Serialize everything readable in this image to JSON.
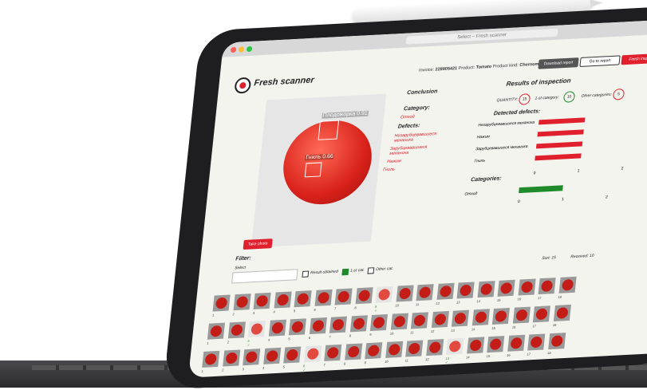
{
  "browser": {
    "url": "Select – Fresh scanner"
  },
  "app": {
    "brand": "Fresh scanner"
  },
  "header": {
    "invoice_label": "Invoice:",
    "invoice_value": "228905421",
    "product_label": "Product:",
    "product_value": "Tomato",
    "kind_label": "Product kind:",
    "kind_value": "Chernomor",
    "download_label": "Download report",
    "goto_label": "Go to report",
    "finish_label": "Finish inspection"
  },
  "photo": {
    "detections": [
      {
        "label": "Плодожорка 0.91"
      },
      {
        "label": "Гниль 0.66"
      }
    ],
    "take_photo_label": "Take photo"
  },
  "conclusion": {
    "title": "Conclusion",
    "category_title": "Category:",
    "category_value": "Отход",
    "defects_title": "Defects:",
    "defects": [
      "Незарубцевавшиеся механика",
      "Зарубцевавшиеся механика",
      "Нажим",
      "Гниль"
    ]
  },
  "results": {
    "title": "Results of inspection",
    "quantity_label": "QUANTITY:",
    "quantity_value": "15",
    "first_label": "1-st category:",
    "first_value": "10",
    "other_label": "Other categories:",
    "other_value": "5",
    "detected_title": "Detected defects:",
    "defect_labels": [
      "Незарубцевавшиеся механика",
      "Нажим",
      "Зарубцевавшиеся механика",
      "Гниль"
    ],
    "defect_ticks": [
      "0",
      "1",
      "2"
    ],
    "categories_title": "Categories:",
    "category_labels": [
      "Отход"
    ],
    "category_ticks": [
      "0",
      "1",
      "2"
    ]
  },
  "chart_data": [
    {
      "type": "bar",
      "categories": [
        "Незарубцевавшиеся механика",
        "Нажим",
        "Зарубцевавшиеся механика",
        "Гниль"
      ],
      "values": [
        1,
        1,
        1,
        1
      ],
      "xlim": [
        0,
        2
      ]
    },
    {
      "type": "bar",
      "categories": [
        "Отход"
      ],
      "values": [
        1
      ],
      "xlim": [
        0,
        2
      ]
    }
  ],
  "filter": {
    "title": "Filter:",
    "select_label": "Select",
    "opt1": "Result obtained",
    "opt2": "1-st cat.",
    "opt3": "Other cat.",
    "sort_label": "Sort: 15",
    "received_label": "Received: 10"
  },
  "rows": [
    [
      "1",
      "2",
      "3",
      "4",
      "5",
      "6",
      "7",
      "8",
      "9 ✓",
      "10",
      "11",
      "12",
      "13",
      "14",
      "15",
      "16",
      "17",
      "18"
    ],
    [
      "1",
      "2",
      "3 ✓",
      "4",
      "5",
      "6",
      "7",
      "8",
      "9",
      "10",
      "11",
      "12",
      "13",
      "14",
      "15",
      "16",
      "17",
      "18"
    ],
    [
      "1",
      "2",
      "3",
      "4",
      "5",
      "6 ✓",
      "7",
      "8",
      "9",
      "10",
      "11",
      "12",
      "13 ✓",
      "14",
      "15",
      "16",
      "17",
      "18"
    ]
  ],
  "colors": {
    "accent": "#e0202d",
    "ok": "#1e8a2a",
    "bg": "#f3f4ee"
  }
}
